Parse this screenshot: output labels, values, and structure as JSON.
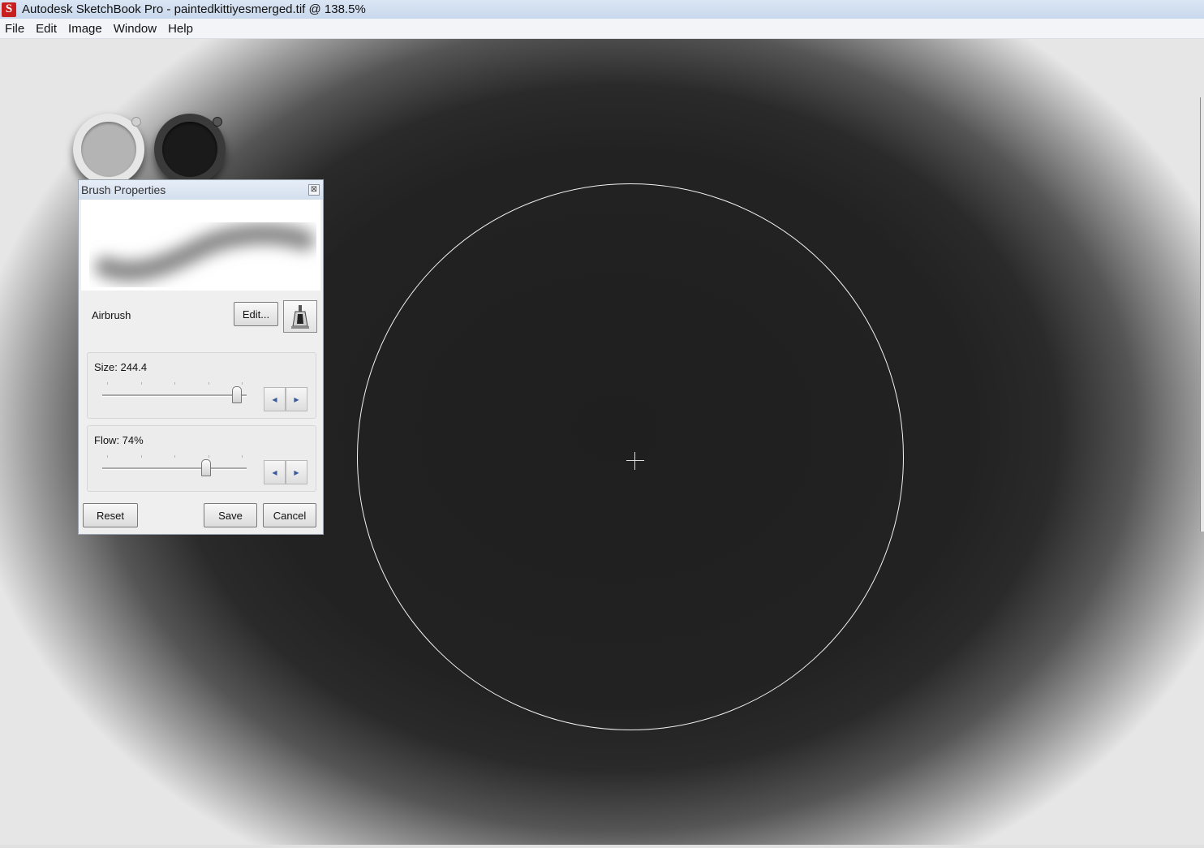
{
  "window": {
    "logo_letter": "S",
    "title": "Autodesk SketchBook Pro - paintedkittiyesmerged.tif @ 138.5%"
  },
  "menu": [
    "File",
    "Edit",
    "Image",
    "Window",
    "Help"
  ],
  "brush_panel": {
    "title": "Brush Properties",
    "close_glyph": "⊠",
    "brush_name": "Airbrush",
    "edit_label": "Edit...",
    "size": {
      "label": "Size: 244.4",
      "slider_fraction": 0.93
    },
    "flow": {
      "label": "Flow: 74%",
      "slider_fraction": 0.72
    },
    "step_left": "◀",
    "step_right": "▶",
    "reset_label": "Reset",
    "save_label": "Save",
    "cancel_label": "Cancel"
  },
  "colors": {
    "primary_puck": "#b4b4b4",
    "secondary_puck": "#1a1a1a"
  }
}
